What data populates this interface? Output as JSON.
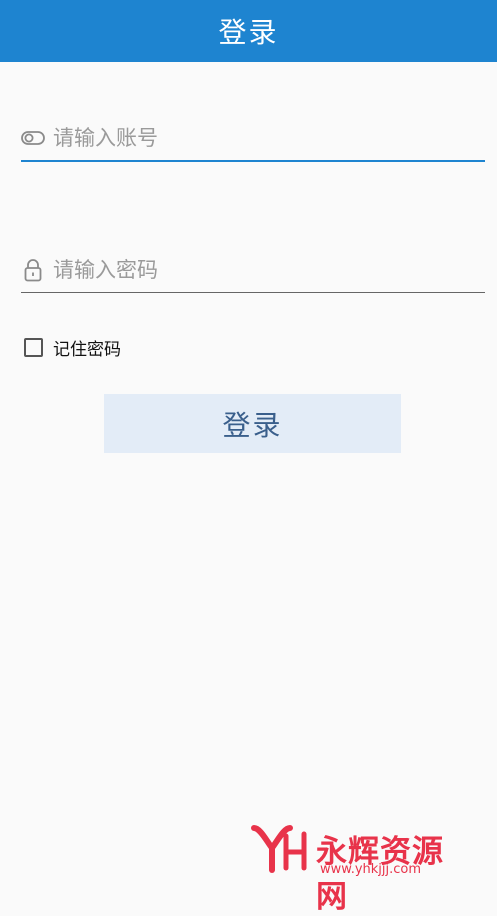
{
  "appbar": {
    "title": "登录"
  },
  "form": {
    "account": {
      "placeholder": "请输入账号",
      "value": "",
      "icon": "account-toggle-icon"
    },
    "password": {
      "placeholder": "请输入密码",
      "value": "",
      "icon": "lock-icon"
    },
    "remember": {
      "label": "记住密码",
      "checked": false
    },
    "submit": {
      "label": "登录"
    }
  },
  "colors": {
    "primary": "#1e84d0",
    "button_bg": "#e3ecf7",
    "button_text": "#3a5f8c",
    "watermark": "#e8334a"
  },
  "watermark": {
    "text": "永辉资源网",
    "url": "www.yhkjjj.com"
  }
}
